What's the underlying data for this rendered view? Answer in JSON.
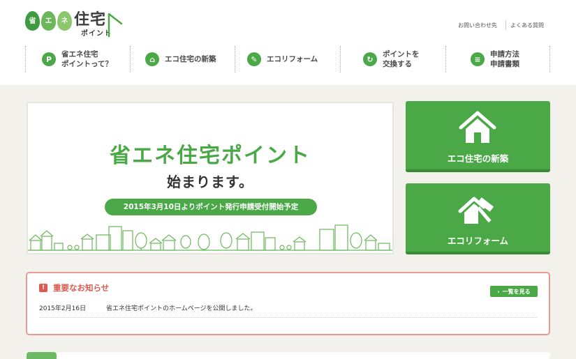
{
  "logo": {
    "leaves": [
      {
        "char": "省",
        "color": "#3e9b3f"
      },
      {
        "char": "エ",
        "color": "#6cb65b"
      },
      {
        "char": "ネ",
        "color": "#8cc76b"
      }
    ],
    "main": "住宅",
    "sub": "ポイント"
  },
  "utility": {
    "contact": "お問い合わせ先",
    "faq": "よくある質問"
  },
  "nav": [
    {
      "icon": "P",
      "label": "省エネ住宅\nポイントって？"
    },
    {
      "icon": "⌂",
      "label": "エコ住宅の新築"
    },
    {
      "icon": "✎",
      "label": "エコリフォーム"
    },
    {
      "icon": "↻",
      "label": "ポイントを\n交換する"
    },
    {
      "icon": "≡",
      "label": "申請方法\n申請書類"
    }
  ],
  "hero": {
    "title": "省エネ住宅ポイント",
    "subtitle": "始まります。",
    "pill": "2015年3月10日よりポイント発行申請受付開始予定"
  },
  "side": {
    "new_build": "エコ住宅の新築",
    "reform": "エコリフォーム"
  },
  "notice": {
    "title": "重要なお知らせ",
    "list_button": "一覧を見る",
    "items": [
      {
        "date": "2015年2月16日",
        "text": "省エネ住宅ポイントのホームページを公開しました。"
      }
    ]
  },
  "colors": {
    "brand_green": "#4aa846",
    "notice_red": "#dd5a4f",
    "background": "#f2f1ec"
  }
}
